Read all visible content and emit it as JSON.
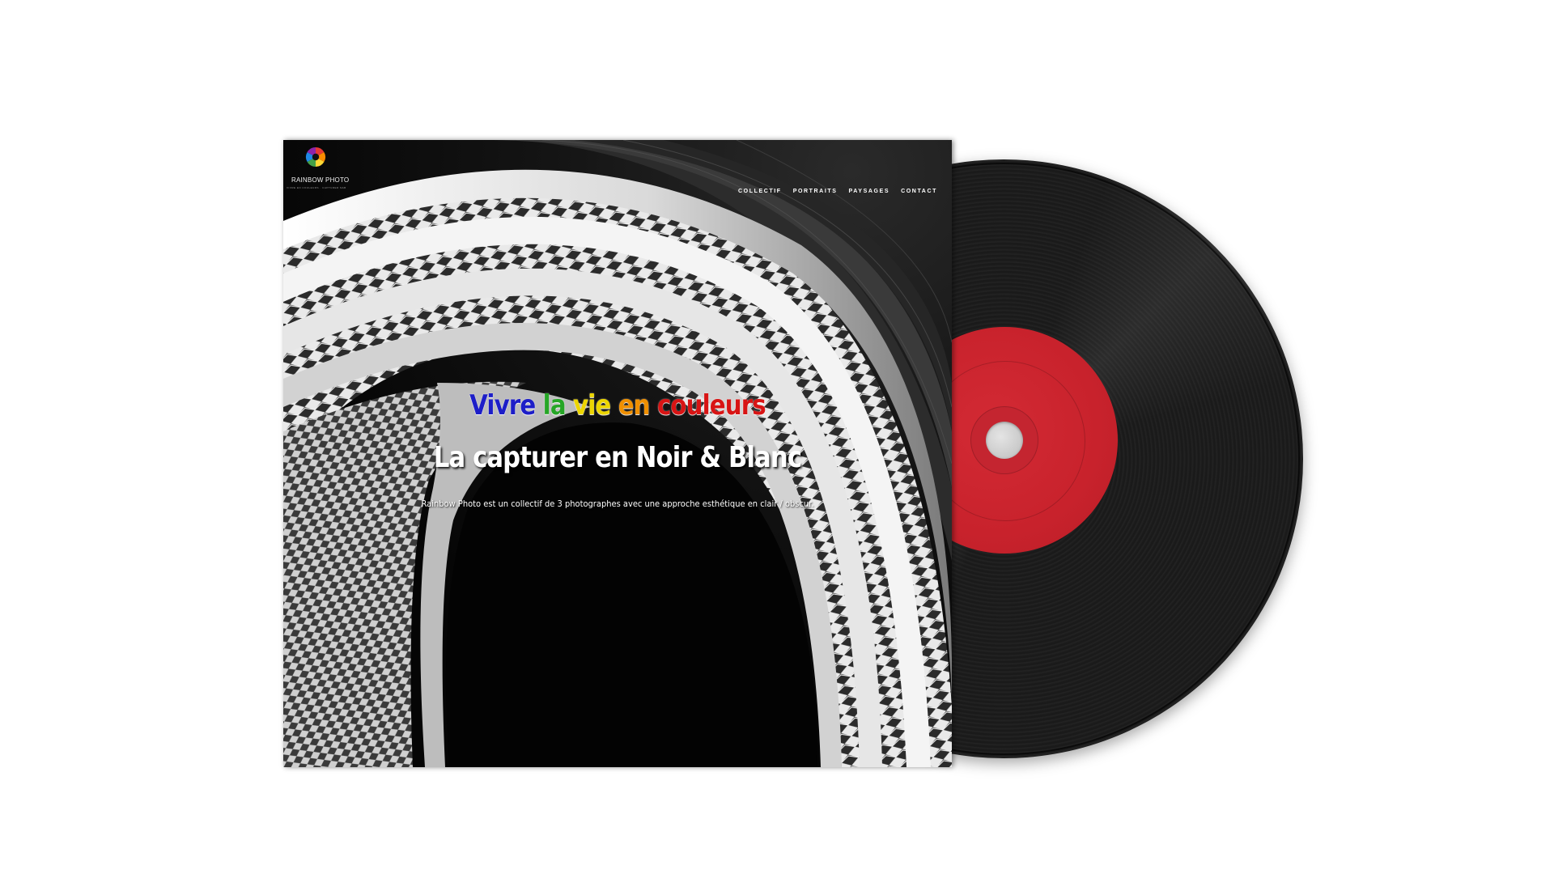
{
  "site": {
    "logo": {
      "name": "RAINBOW PHOTO",
      "tagline": "VIVRE EN COULEURS · CAPTURER N&B"
    },
    "nav": [
      {
        "label": "COLLECTIF"
      },
      {
        "label": "PORTRAITS"
      },
      {
        "label": "PAYSAGES"
      },
      {
        "label": "CONTACT"
      }
    ]
  },
  "hero": {
    "line1": {
      "w1": "Vivre",
      "w2": "la",
      "w3": "vie",
      "w4": "en",
      "w5": "couleurs"
    },
    "line2": "La capturer en Noir & Blanc",
    "description": "Rainbow Photo est un collectif de 3 photographes avec une approche esthétique en clair / obscur."
  },
  "colors": {
    "vivre": "#1d1ec8",
    "la": "#26a626",
    "vie": "#ecd500",
    "en": "#f09000",
    "couleurs": "#d81414",
    "record_label": "#c8222c",
    "vinyl": "#1c1c1c",
    "background": "#ffffff"
  },
  "icons": {
    "logo": "rainbow-aperture-icon"
  }
}
